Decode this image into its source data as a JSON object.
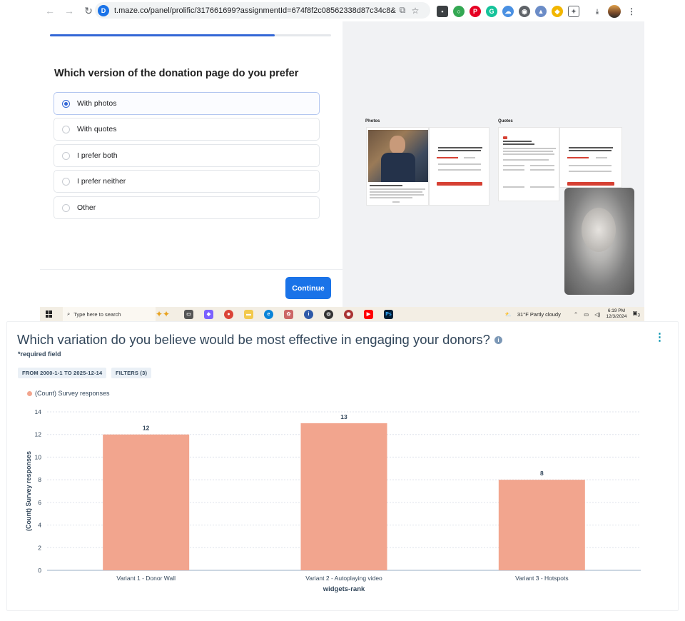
{
  "browser": {
    "url": "t.maze.co/panel/prolific/317661699?assignmentId=674f8f2c08562338d87c34c8&workerId=65c2...",
    "site_icon": "D"
  },
  "maze": {
    "progress": 0.8,
    "question": "Which version of the donation page do you prefer",
    "options": [
      "With photos",
      "With quotes",
      "I prefer both",
      "I prefer neither",
      "Other"
    ],
    "selected_option": "With photos",
    "continue_label": "Continue",
    "preview": {
      "label_photos": "Photos",
      "label_quotes": "Quotes"
    }
  },
  "taskbar": {
    "search_placeholder": "Type here to search",
    "weather": "31°F  Partly cloudy",
    "time": "6:19 PM",
    "date": "12/3/2024",
    "notifications": "3"
  },
  "report": {
    "title": "Which variation do you believe would be most effective in engaging your donors?",
    "required_note": "*required field",
    "filter_date": "FROM 2000-1-1 TO 2025-12-14",
    "filter_count": "FILTERS (3)",
    "info_icon": "i"
  },
  "colors": {
    "bar": "#f2a58e",
    "accent": "#1a73e8",
    "title": "#33475b"
  },
  "chart_data": {
    "type": "bar",
    "categories": [
      "Variant 1 - Donor Wall",
      "Variant 2 - Autoplaying video",
      "Variant 3 - Hotspots"
    ],
    "series": [
      {
        "name": "(Count) Survey responses",
        "values": [
          12,
          13,
          8
        ]
      }
    ],
    "xlabel": "widgets-rank",
    "ylabel": "(Count) Survey responses",
    "ylim": [
      0,
      14
    ],
    "yticks": [
      0,
      2,
      4,
      6,
      8,
      10,
      12,
      14
    ],
    "grid": true,
    "legend": "top-left"
  }
}
